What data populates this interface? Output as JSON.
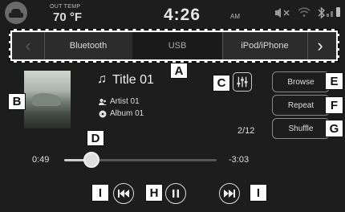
{
  "status": {
    "out_temp_label": "OUT TEMP",
    "out_temp_value": "70 °F",
    "time": "4:26",
    "ampm": "AM"
  },
  "tabs": {
    "items": [
      "Bluetooth",
      "USB",
      "iPod/iPhone"
    ],
    "active": "USB"
  },
  "track": {
    "title": "Title 01",
    "artist": "Artist 01",
    "album": "Album 01",
    "counter": "2/12",
    "elapsed": "0:49",
    "remaining": "-3:03",
    "progress": 0.18
  },
  "side_buttons": [
    "Browse",
    "Repeat",
    "Shuffle"
  ],
  "callouts": {
    "A": "A",
    "B": "B",
    "C": "C",
    "D": "D",
    "E": "E",
    "F": "F",
    "G": "G",
    "H": "H",
    "I": "I"
  },
  "icons": [
    "car-icon",
    "mute-icon",
    "wifi-icon",
    "bluetooth-icon",
    "battery-icon",
    "music-note-icon",
    "artist-icon",
    "album-icon",
    "equalizer-icon",
    "previous-track-icon",
    "pause-icon",
    "next-track-icon",
    "chevron-left-icon",
    "chevron-right-icon"
  ]
}
